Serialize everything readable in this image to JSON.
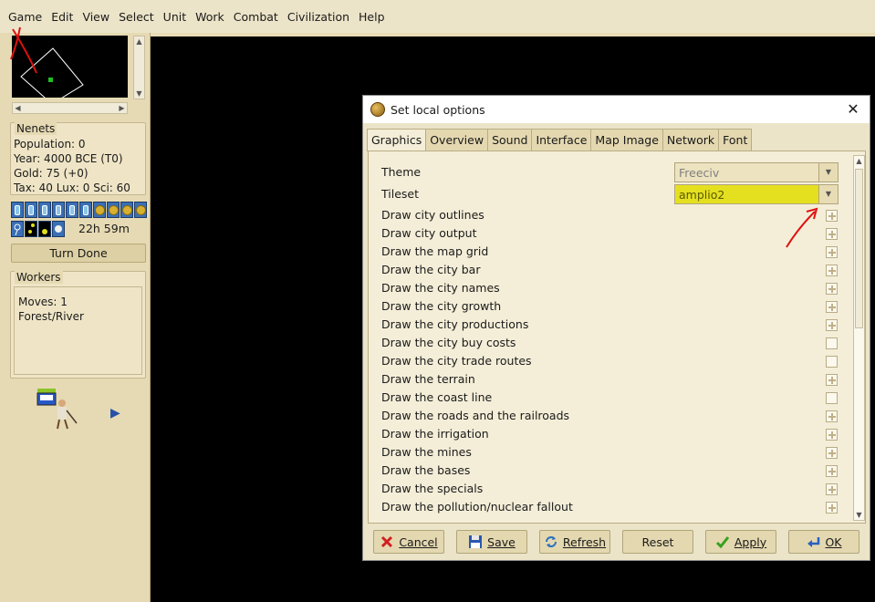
{
  "menubar": {
    "items": [
      {
        "label": "Game"
      },
      {
        "label": "Edit"
      },
      {
        "label": "View"
      },
      {
        "label": "Select"
      },
      {
        "label": "Unit"
      },
      {
        "label": "Work"
      },
      {
        "label": "Combat"
      },
      {
        "label": "Civilization"
      },
      {
        "label": "Help"
      }
    ]
  },
  "player": {
    "name": "Nenets",
    "population": "Population: 0",
    "year": "Year: 4000 BCE (T0)",
    "gold": "Gold: 75 (+0)",
    "tax": "Tax: 40 Lux: 0 Sci: 60",
    "timer": "22h 59m",
    "turn_done": "Turn Done"
  },
  "unit_info": {
    "title": "Workers",
    "moves": "Moves: 1",
    "terrain": "Forest/River"
  },
  "dialog": {
    "title": "Set local options",
    "tabs": [
      "Graphics",
      "Overview",
      "Sound",
      "Interface",
      "Map Image",
      "Network",
      "Font"
    ],
    "active_tab": "Graphics",
    "theme_label": "Theme",
    "theme_value": "Freeciv",
    "tileset_label": "Tileset",
    "tileset_value": "amplio2",
    "options": [
      {
        "label": "Draw city outlines",
        "checked": true
      },
      {
        "label": "Draw city output",
        "checked": true
      },
      {
        "label": "Draw the map grid",
        "checked": true
      },
      {
        "label": "Draw the city bar",
        "checked": true
      },
      {
        "label": "Draw the city names",
        "checked": true
      },
      {
        "label": "Draw the city growth",
        "checked": true
      },
      {
        "label": "Draw the city productions",
        "checked": true
      },
      {
        "label": "Draw the city buy costs",
        "checked": false
      },
      {
        "label": "Draw the city trade routes",
        "checked": false
      },
      {
        "label": "Draw the terrain",
        "checked": true
      },
      {
        "label": "Draw the coast line",
        "checked": false
      },
      {
        "label": "Draw the roads and the railroads",
        "checked": true
      },
      {
        "label": "Draw the irrigation",
        "checked": true
      },
      {
        "label": "Draw the mines",
        "checked": true
      },
      {
        "label": "Draw the bases",
        "checked": true
      },
      {
        "label": "Draw the specials",
        "checked": true
      },
      {
        "label": "Draw the pollution/nuclear fallout",
        "checked": true
      }
    ],
    "buttons": {
      "cancel": "Cancel",
      "save": "Save",
      "refresh": "Refresh",
      "reset": "Reset",
      "apply": "Apply",
      "ok": "OK"
    }
  },
  "colors": {
    "highlight": "#e4e020",
    "annotation": "#e01010",
    "map_bg": "#000000"
  }
}
